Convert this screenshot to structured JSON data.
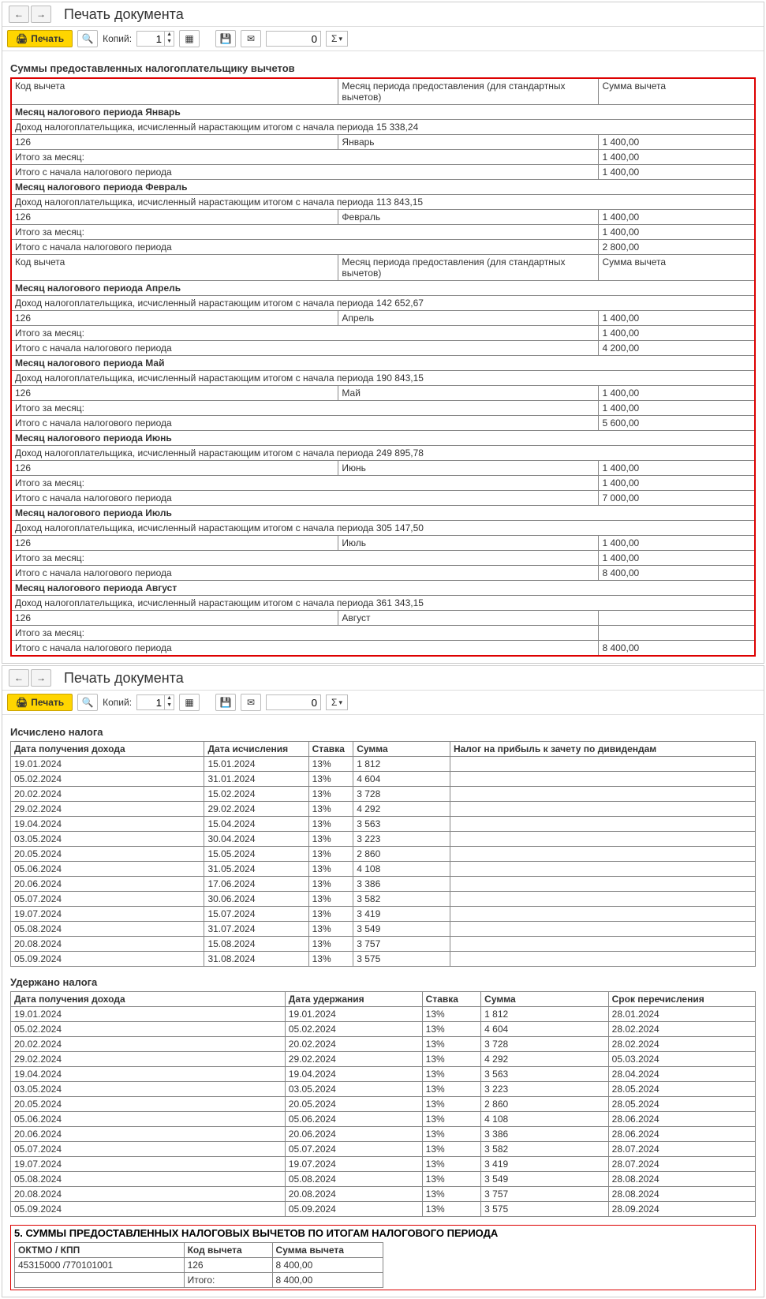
{
  "window_title": "Печать документа",
  "toolbar": {
    "print": "Печать",
    "copies_label": "Копий:",
    "copies_value": "1",
    "page_value": "0",
    "sigma": "Σ"
  },
  "section1": {
    "title": "Суммы предоставленных налогоплательщику вычетов",
    "header": {
      "code": "Код вычета",
      "month": "Месяц периода предоставления (для стандартных вычетов)",
      "sum": "Сумма вычета"
    },
    "labels": {
      "month_period": "Месяц налогового периода",
      "income": "Доход налогоплательщика, исчисленный нарастающим итогом с начала периода",
      "month_total": "Итого за месяц:",
      "period_total": "Итого с начала налогового периода"
    },
    "months": [
      {
        "name": "Январь",
        "income": "15 338,24",
        "code": "126",
        "amount": "1 400,00",
        "month_total": "1 400,00",
        "period_total": "1 400,00"
      },
      {
        "name": "Февраль",
        "income": "113 843,15",
        "code": "126",
        "amount": "1 400,00",
        "month_total": "1 400,00",
        "period_total": "2 800,00"
      },
      {
        "name": "Апрель",
        "income": "142 652,67",
        "code": "126",
        "amount": "1 400,00",
        "month_total": "1 400,00",
        "period_total": "4 200,00"
      },
      {
        "name": "Май",
        "income": "190 843,15",
        "code": "126",
        "amount": "1 400,00",
        "month_total": "1 400,00",
        "period_total": "5 600,00"
      },
      {
        "name": "Июнь",
        "income": "249 895,78",
        "code": "126",
        "amount": "1 400,00",
        "month_total": "1 400,00",
        "period_total": "7 000,00"
      },
      {
        "name": "Июль",
        "income": "305 147,50",
        "code": "126",
        "amount": "1 400,00",
        "month_total": "1 400,00",
        "period_total": "8 400,00"
      },
      {
        "name": "Август",
        "income": "361 343,15",
        "code": "126",
        "amount": "",
        "month_total": "",
        "period_total": "8 400,00"
      }
    ],
    "repeat_header_after": 2
  },
  "section2": {
    "title": "Исчислено налога",
    "header": {
      "c1": "Дата получения дохода",
      "c2": "Дата исчисления",
      "c3": "Ставка",
      "c4": "Сумма",
      "c5": "Налог на прибыль к зачету по дивидендам"
    },
    "rows": [
      {
        "c1": "19.01.2024",
        "c2": "15.01.2024",
        "c3": "13%",
        "c4": "1 812",
        "c5": ""
      },
      {
        "c1": "05.02.2024",
        "c2": "31.01.2024",
        "c3": "13%",
        "c4": "4 604",
        "c5": ""
      },
      {
        "c1": "20.02.2024",
        "c2": "15.02.2024",
        "c3": "13%",
        "c4": "3 728",
        "c5": ""
      },
      {
        "c1": "29.02.2024",
        "c2": "29.02.2024",
        "c3": "13%",
        "c4": "4 292",
        "c5": ""
      },
      {
        "c1": "19.04.2024",
        "c2": "15.04.2024",
        "c3": "13%",
        "c4": "3 563",
        "c5": ""
      },
      {
        "c1": "03.05.2024",
        "c2": "30.04.2024",
        "c3": "13%",
        "c4": "3 223",
        "c5": ""
      },
      {
        "c1": "20.05.2024",
        "c2": "15.05.2024",
        "c3": "13%",
        "c4": "2 860",
        "c5": ""
      },
      {
        "c1": "05.06.2024",
        "c2": "31.05.2024",
        "c3": "13%",
        "c4": "4 108",
        "c5": ""
      },
      {
        "c1": "20.06.2024",
        "c2": "17.06.2024",
        "c3": "13%",
        "c4": "3 386",
        "c5": ""
      },
      {
        "c1": "05.07.2024",
        "c2": "30.06.2024",
        "c3": "13%",
        "c4": "3 582",
        "c5": ""
      },
      {
        "c1": "19.07.2024",
        "c2": "15.07.2024",
        "c3": "13%",
        "c4": "3 419",
        "c5": ""
      },
      {
        "c1": "05.08.2024",
        "c2": "31.07.2024",
        "c3": "13%",
        "c4": "3 549",
        "c5": ""
      },
      {
        "c1": "20.08.2024",
        "c2": "15.08.2024",
        "c3": "13%",
        "c4": "3 757",
        "c5": ""
      },
      {
        "c1": "05.09.2024",
        "c2": "31.08.2024",
        "c3": "13%",
        "c4": "3 575",
        "c5": ""
      }
    ]
  },
  "section3": {
    "title": "Удержано налога",
    "header": {
      "c1": "Дата получения дохода",
      "c2": "Дата удержания",
      "c3": "Ставка",
      "c4": "Сумма",
      "c5": "Срок перечисления"
    },
    "rows": [
      {
        "c1": "19.01.2024",
        "c2": "19.01.2024",
        "c3": "13%",
        "c4": "1 812",
        "c5": "28.01.2024"
      },
      {
        "c1": "05.02.2024",
        "c2": "05.02.2024",
        "c3": "13%",
        "c4": "4 604",
        "c5": "28.02.2024"
      },
      {
        "c1": "20.02.2024",
        "c2": "20.02.2024",
        "c3": "13%",
        "c4": "3 728",
        "c5": "28.02.2024"
      },
      {
        "c1": "29.02.2024",
        "c2": "29.02.2024",
        "c3": "13%",
        "c4": "4 292",
        "c5": "05.03.2024"
      },
      {
        "c1": "19.04.2024",
        "c2": "19.04.2024",
        "c3": "13%",
        "c4": "3 563",
        "c5": "28.04.2024"
      },
      {
        "c1": "03.05.2024",
        "c2": "03.05.2024",
        "c3": "13%",
        "c4": "3 223",
        "c5": "28.05.2024"
      },
      {
        "c1": "20.05.2024",
        "c2": "20.05.2024",
        "c3": "13%",
        "c4": "2 860",
        "c5": "28.05.2024"
      },
      {
        "c1": "05.06.2024",
        "c2": "05.06.2024",
        "c3": "13%",
        "c4": "4 108",
        "c5": "28.06.2024"
      },
      {
        "c1": "20.06.2024",
        "c2": "20.06.2024",
        "c3": "13%",
        "c4": "3 386",
        "c5": "28.06.2024"
      },
      {
        "c1": "05.07.2024",
        "c2": "05.07.2024",
        "c3": "13%",
        "c4": "3 582",
        "c5": "28.07.2024"
      },
      {
        "c1": "19.07.2024",
        "c2": "19.07.2024",
        "c3": "13%",
        "c4": "3 419",
        "c5": "28.07.2024"
      },
      {
        "c1": "05.08.2024",
        "c2": "05.08.2024",
        "c3": "13%",
        "c4": "3 549",
        "c5": "28.08.2024"
      },
      {
        "c1": "20.08.2024",
        "c2": "20.08.2024",
        "c3": "13%",
        "c4": "3 757",
        "c5": "28.08.2024"
      },
      {
        "c1": "05.09.2024",
        "c2": "05.09.2024",
        "c3": "13%",
        "c4": "3 575",
        "c5": "28.09.2024"
      }
    ]
  },
  "section5": {
    "title": "5. СУММЫ ПРЕДОСТАВЛЕННЫХ НАЛОГОВЫХ ВЫЧЕТОВ ПО ИТОГАМ НАЛОГОВОГО ПЕРИОДА",
    "header": {
      "c1": "ОКТМО / КПП",
      "c2": "Код вычета",
      "c3": "Сумма вычета"
    },
    "rows": [
      {
        "c1": "45315000   /770101001",
        "c2": "126",
        "c3": "8 400,00"
      },
      {
        "c1": "",
        "c2": "Итого:",
        "c3": "8 400,00"
      }
    ]
  }
}
